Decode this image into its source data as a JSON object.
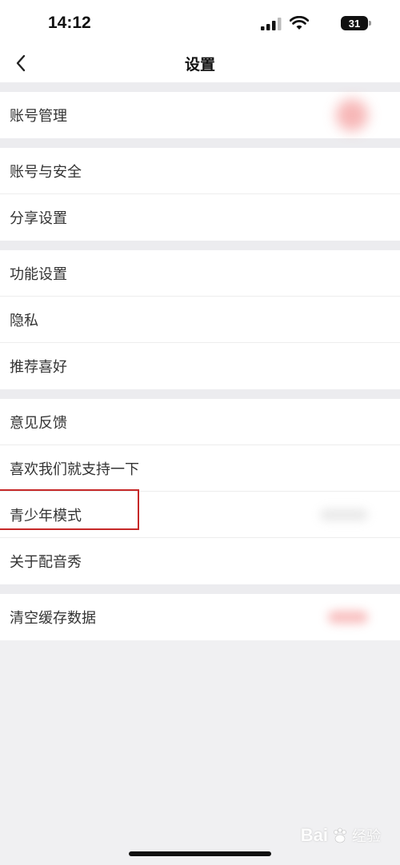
{
  "status_bar": {
    "time": "14:12",
    "battery": "31"
  },
  "header": {
    "title": "设置"
  },
  "groups": [
    {
      "items": [
        {
          "label": "账号管理"
        }
      ]
    },
    {
      "items": [
        {
          "label": "账号与安全"
        },
        {
          "label": "分享设置"
        }
      ]
    },
    {
      "items": [
        {
          "label": "功能设置"
        },
        {
          "label": "隐私"
        },
        {
          "label": "推荐喜好"
        }
      ]
    },
    {
      "items": [
        {
          "label": "意见反馈"
        },
        {
          "label": "喜欢我们就支持一下"
        },
        {
          "label": "青少年模式"
        },
        {
          "label": "关于配音秀"
        }
      ]
    },
    {
      "items": [
        {
          "label": "清空缓存数据"
        }
      ]
    }
  ],
  "highlight": {
    "target": "青少年模式",
    "color": "#c62828"
  },
  "watermark": {
    "brand": "Bai",
    "sub": "经验"
  },
  "icons": {
    "back": "chevron-left-icon",
    "signal": "cellular-signal-icon",
    "wifi": "wifi-icon",
    "battery": "battery-icon"
  }
}
